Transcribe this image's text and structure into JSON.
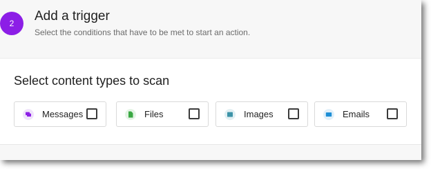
{
  "step": {
    "number": "2",
    "title": "Add a trigger",
    "subtitle": "Select the conditions that have to be met to start an action."
  },
  "scan": {
    "heading": "Select content types to scan",
    "types": [
      {
        "label": "Messages",
        "icon": "message-icon",
        "icon_color": "#8c1ee6",
        "icon_bg": "#efe3fb",
        "checked": false
      },
      {
        "label": "Files",
        "icon": "file-icon",
        "icon_color": "#3aa843",
        "icon_bg": "#e4f4e5",
        "checked": false
      },
      {
        "label": "Images",
        "icon": "image-icon",
        "icon_color": "#3d93a8",
        "icon_bg": "#e2f0f3",
        "checked": false
      },
      {
        "label": "Emails",
        "icon": "email-icon",
        "icon_color": "#1e8fd6",
        "icon_bg": "#e1f0fa",
        "checked": false
      }
    ]
  },
  "colors": {
    "accent": "#8c1ee6"
  }
}
